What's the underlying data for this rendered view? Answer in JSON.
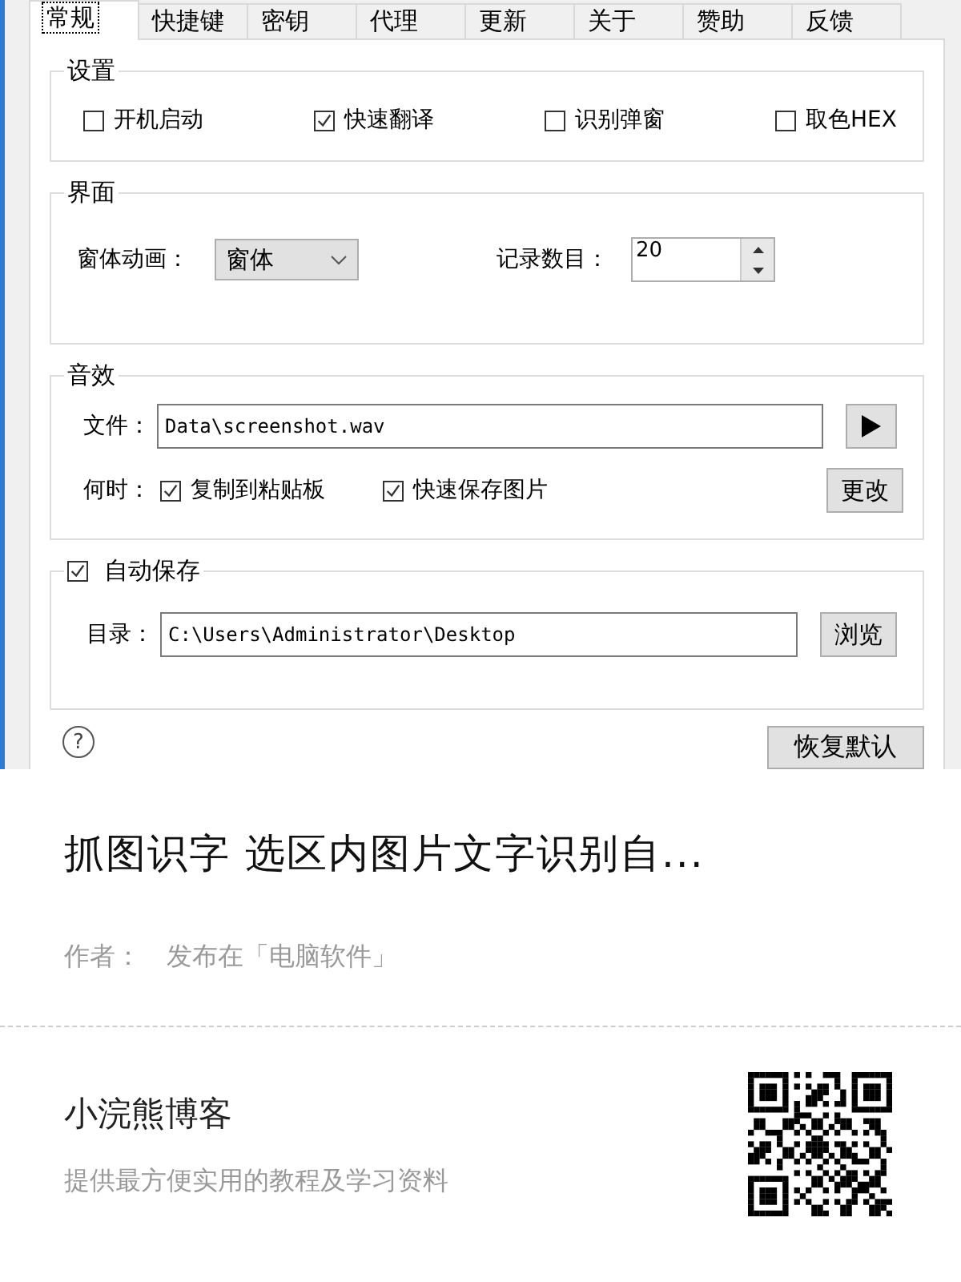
{
  "tabs": [
    {
      "label": "常规",
      "selected": true
    },
    {
      "label": "快捷键",
      "selected": false
    },
    {
      "label": "密钥",
      "selected": false
    },
    {
      "label": "代理",
      "selected": false
    },
    {
      "label": "更新",
      "selected": false
    },
    {
      "label": "关于",
      "selected": false
    },
    {
      "label": "赞助",
      "selected": false
    },
    {
      "label": "反馈",
      "selected": false
    }
  ],
  "settings_group": {
    "title": "设置",
    "options": [
      {
        "label": "开机启动",
        "checked": false
      },
      {
        "label": "快速翻译",
        "checked": true
      },
      {
        "label": "识别弹窗",
        "checked": false
      },
      {
        "label": "取色HEX",
        "checked": false
      }
    ]
  },
  "interface_group": {
    "title": "界面",
    "animation_label": "窗体动画：",
    "animation_value": "窗体",
    "record_label": "记录数目：",
    "record_value": "20"
  },
  "sound_group": {
    "title": "音效",
    "file_label": "文件：",
    "file_value": "Data\\screenshot.wav",
    "when_label": "何时：",
    "options": [
      {
        "label": "复制到粘贴板",
        "checked": true
      },
      {
        "label": "快速保存图片",
        "checked": true
      }
    ],
    "change_button": "更改"
  },
  "autosave_group": {
    "title": "自动保存",
    "checked": true,
    "dir_label": "目录：",
    "dir_value": "C:\\Users\\Administrator\\Desktop",
    "browse_button": "浏览"
  },
  "footer": {
    "help_button": "?",
    "restore_button": "恢复默认"
  },
  "article": {
    "title": "抓图识字 选区内图片文字识别自...",
    "author_label": "作者：",
    "published_in": "发布在「电脑软件」"
  },
  "blog": {
    "name": "小浣熊博客",
    "tagline": "提供最方便实用的教程及学习资料"
  }
}
